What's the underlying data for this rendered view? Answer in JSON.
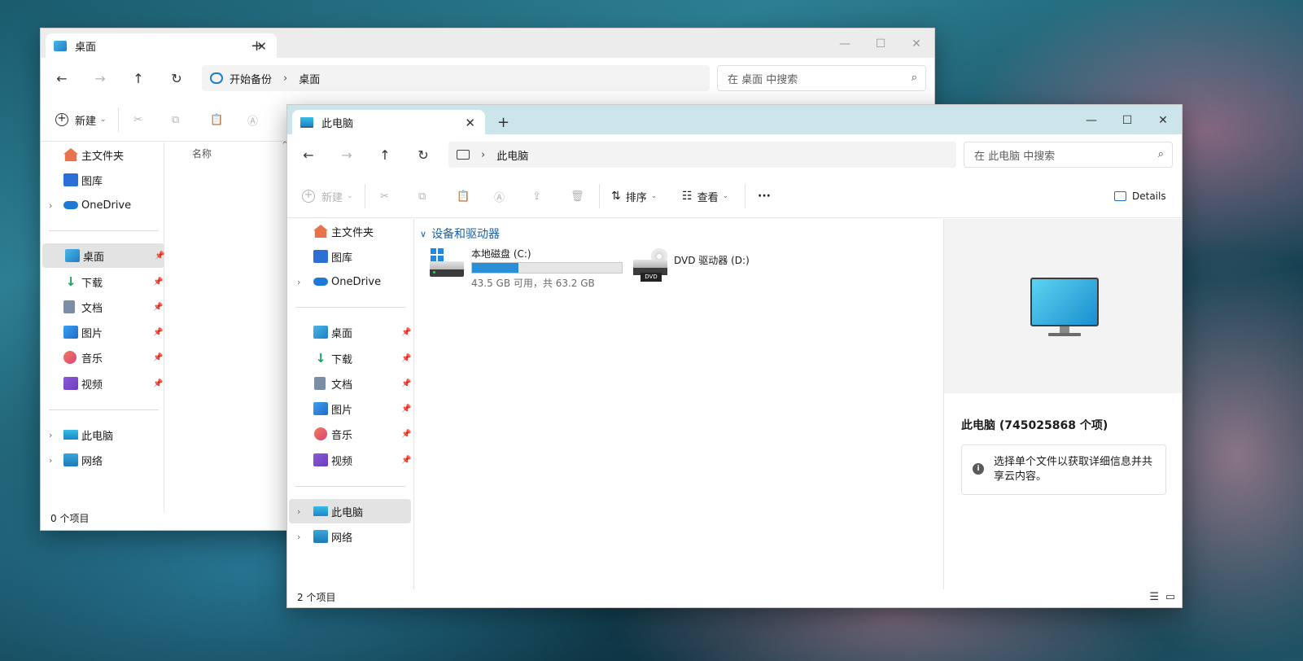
{
  "back_window": {
    "tab_title": "桌面",
    "tab_close": "✕",
    "new_tab": "+",
    "minimize": "—",
    "maximize": "☐",
    "close": "✕",
    "address": {
      "backup_label": "开始备份",
      "separator": "›",
      "location": "桌面"
    },
    "search_placeholder": "在 桌面 中搜索",
    "toolbar": {
      "new_label": "新建"
    },
    "column_header": "名称",
    "sidebar": {
      "quick": [
        {
          "label": "主文件夹",
          "icon": "home-icon"
        },
        {
          "label": "图库",
          "icon": "gallery-icon"
        },
        {
          "label": "OneDrive",
          "icon": "onedrive-icon"
        }
      ],
      "pinned": [
        {
          "label": "桌面",
          "icon": "desktop-icon"
        },
        {
          "label": "下载",
          "icon": "download-icon"
        },
        {
          "label": "文档",
          "icon": "document-icon"
        },
        {
          "label": "图片",
          "icon": "pictures-icon"
        },
        {
          "label": "音乐",
          "icon": "music-icon"
        },
        {
          "label": "视频",
          "icon": "video-icon"
        }
      ],
      "bottom": [
        {
          "label": "此电脑",
          "icon": "this-pc-icon"
        },
        {
          "label": "网络",
          "icon": "network-icon"
        }
      ]
    },
    "status": "0 个项目"
  },
  "front_window": {
    "tab_title": "此电脑",
    "tab_close": "✕",
    "new_tab": "+",
    "minimize": "—",
    "maximize": "☐",
    "close": "✕",
    "address": {
      "separator": "›",
      "location": "此电脑"
    },
    "search_placeholder": "在 此电脑 中搜索",
    "toolbar": {
      "new_label": "新建",
      "sort_label": "排序",
      "view_label": "查看",
      "more_label": "···",
      "details_label": "Details"
    },
    "section_title": "设备和驱动器",
    "drives": [
      {
        "name": "本地磁盘 (C:)",
        "space": "43.5 GB 可用，共 63.2 GB",
        "used_fraction": 0.31
      },
      {
        "name": "DVD 驱动器 (D:)",
        "badge": "DVD"
      }
    ],
    "sidebar": {
      "quick": [
        {
          "label": "主文件夹",
          "icon": "home-icon"
        },
        {
          "label": "图库",
          "icon": "gallery-icon"
        },
        {
          "label": "OneDrive",
          "icon": "onedrive-icon"
        }
      ],
      "pinned": [
        {
          "label": "桌面",
          "icon": "desktop-icon"
        },
        {
          "label": "下载",
          "icon": "download-icon"
        },
        {
          "label": "文档",
          "icon": "document-icon"
        },
        {
          "label": "图片",
          "icon": "pictures-icon"
        },
        {
          "label": "音乐",
          "icon": "music-icon"
        },
        {
          "label": "视频",
          "icon": "video-icon"
        }
      ],
      "bottom": [
        {
          "label": "此电脑",
          "icon": "this-pc-icon",
          "selected": true
        },
        {
          "label": "网络",
          "icon": "network-icon"
        }
      ]
    },
    "details_pane": {
      "title": "此电脑 (745025868 个项)",
      "info": "选择单个文件以获取详细信息并共享云内容。"
    },
    "status": "2 个项目"
  },
  "colors": {
    "accent": "#1f8ad2",
    "titlebar_back": "#ececec",
    "titlebar_front": "#cbe5ea",
    "section_title": "#1a5fa8"
  }
}
